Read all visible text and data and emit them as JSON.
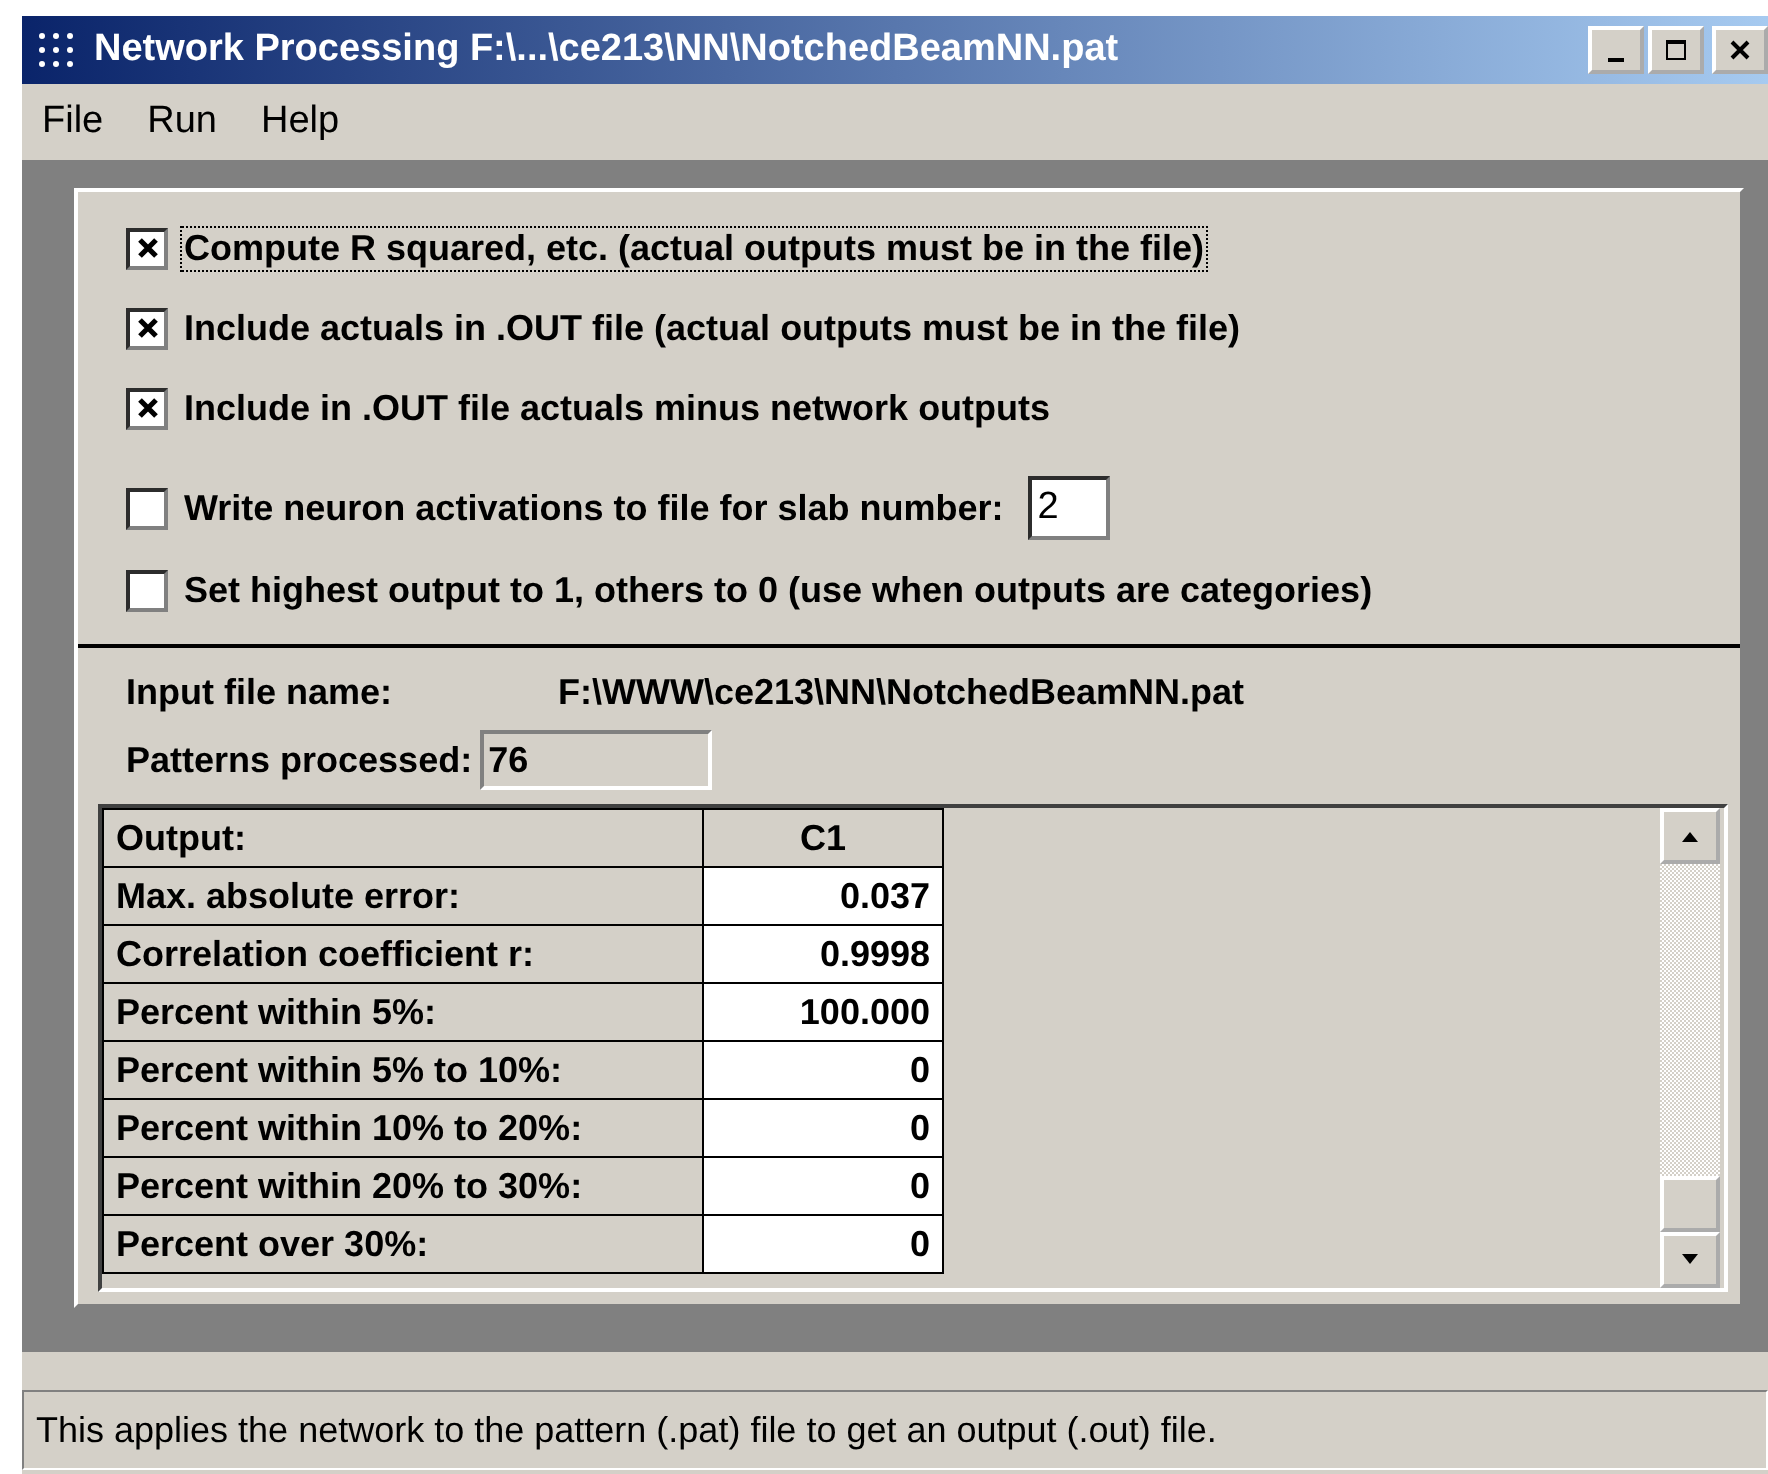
{
  "window": {
    "title": "Network Processing F:\\...\\ce213\\NN\\NotchedBeamNN.pat"
  },
  "menu": [
    "File",
    "Run",
    "Help"
  ],
  "options": [
    {
      "label": "Compute R squared, etc. (actual outputs must be in the file)",
      "checked": true,
      "focused": true
    },
    {
      "label": "Include actuals in .OUT file (actual outputs must be in the file)",
      "checked": true,
      "focused": false
    },
    {
      "label": "Include in .OUT file actuals minus network outputs",
      "checked": true,
      "focused": false
    },
    {
      "label": "Write neuron activations to file for slab number:",
      "checked": false,
      "focused": false,
      "value": "2"
    },
    {
      "label": "Set highest output to 1, others to 0 (use when outputs are categories)",
      "checked": false,
      "focused": false
    }
  ],
  "input_file": {
    "label": "Input file name:",
    "value": "F:\\WWW\\ce213\\NN\\NotchedBeamNN.pat"
  },
  "patterns": {
    "label": "Patterns processed:",
    "value": "76"
  },
  "table": {
    "columns": [
      "Output:",
      "C1"
    ],
    "rows": [
      [
        "Max. absolute error:",
        "0.037"
      ],
      [
        "Correlation coefficient r:",
        "0.9998"
      ],
      [
        "Percent within 5%:",
        "100.000"
      ],
      [
        "Percent within 5% to 10%:",
        "0"
      ],
      [
        "Percent within 10% to 20%:",
        "0"
      ],
      [
        "Percent within 20% to 30%:",
        "0"
      ],
      [
        "Percent over 30%:",
        "0"
      ]
    ]
  },
  "status_bar": "This applies the network to the pattern (.pat) file to get an output (.out) file."
}
